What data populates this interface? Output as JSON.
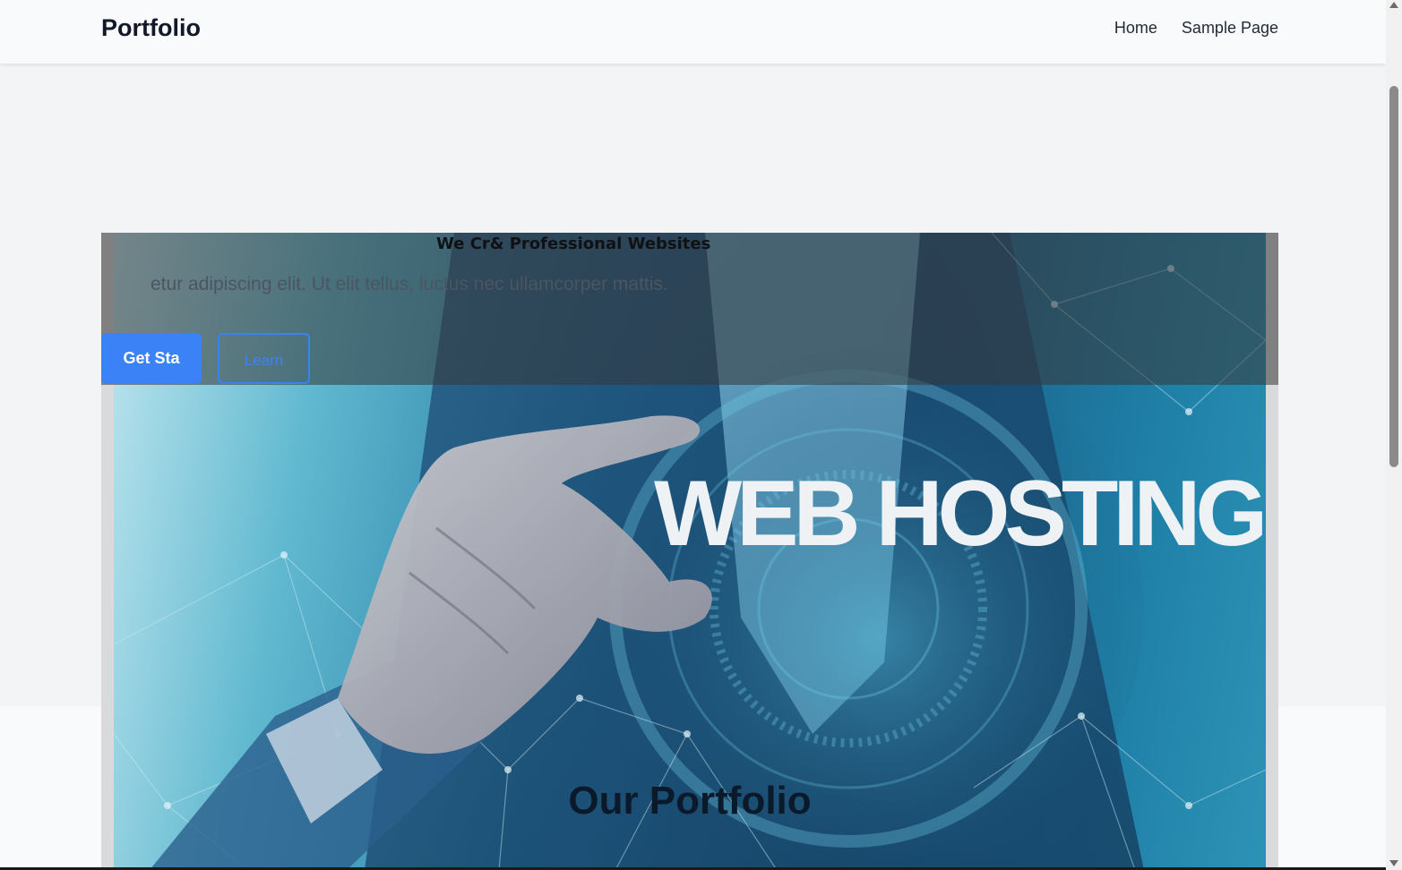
{
  "header": {
    "brand": "Portfolio",
    "nav": [
      {
        "label": "Home"
      },
      {
        "label": "Sample Page"
      }
    ]
  },
  "hero": {
    "title": "We Cr& Professional Websites",
    "subtitle": "etur adipiscing elit. Ut elit tellus, luctus nec ullamcorper mattis.",
    "primary_button": "Get Sta",
    "secondary_button": "Learn",
    "image_text": "WEB HOSTING"
  },
  "portfolio": {
    "title": "Our Portfolio"
  },
  "colors": {
    "accent": "#3b82f6",
    "header_bg": "#f9fafb",
    "page_bg": "#f3f4f6"
  },
  "icons": {
    "scroll_up": "triangle-up-icon",
    "scroll_down": "triangle-down-icon"
  }
}
